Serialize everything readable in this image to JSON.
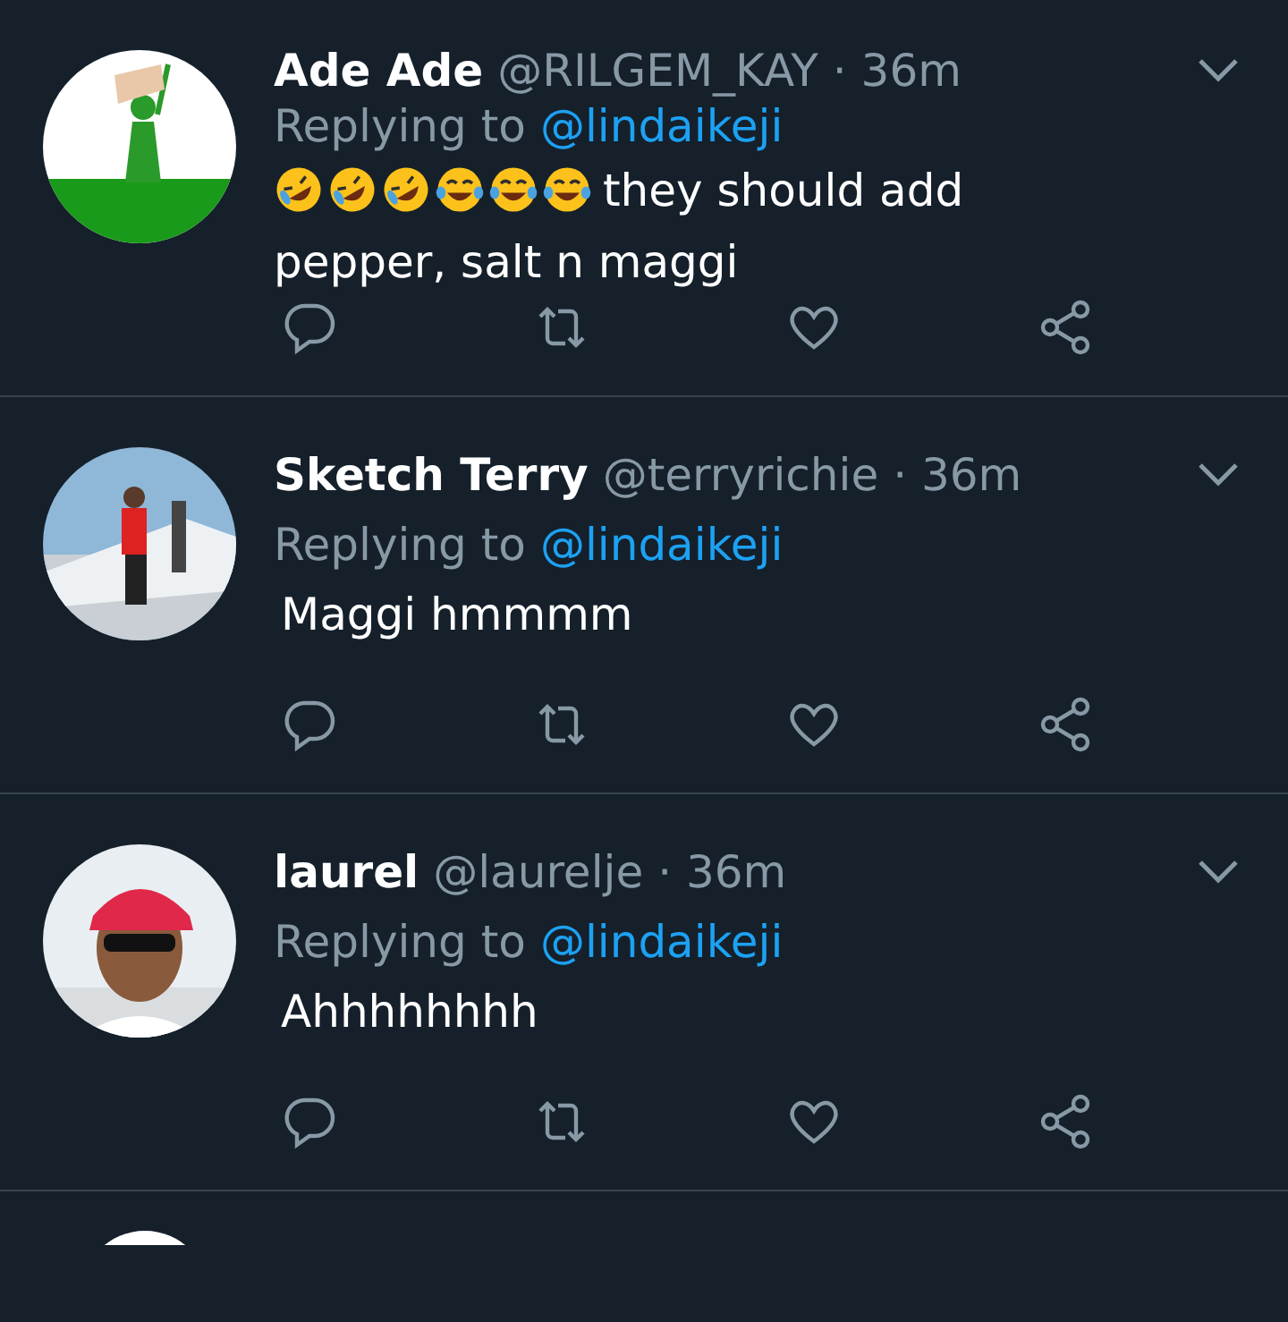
{
  "tweets": [
    {
      "name": "Ade Ade",
      "handle": "@RILGEM_KAY",
      "time": "· 36m",
      "replying_prefix": "Replying to",
      "replying_to": "@lindaikeji",
      "emojis": [
        {
          "kind": "rofl"
        },
        {
          "kind": "rofl"
        },
        {
          "kind": "rofl"
        },
        {
          "kind": "joy"
        },
        {
          "kind": "joy"
        },
        {
          "kind": "joy"
        }
      ],
      "lines": [
        "they should add",
        "pepper, salt n maggi"
      ]
    },
    {
      "name": "Sketch Terry",
      "handle": "@terryrichie",
      "time": "· 36m",
      "replying_prefix": "Replying to",
      "replying_to": "@lindaikeji",
      "lines": [
        "Maggi hmmmm"
      ]
    },
    {
      "name": "laurel",
      "handle": "@laurelje",
      "time": "· 36m",
      "replying_prefix": "Replying to",
      "replying_to": "@lindaikeji",
      "lines": [
        "Ahhhhhhhh"
      ]
    }
  ]
}
